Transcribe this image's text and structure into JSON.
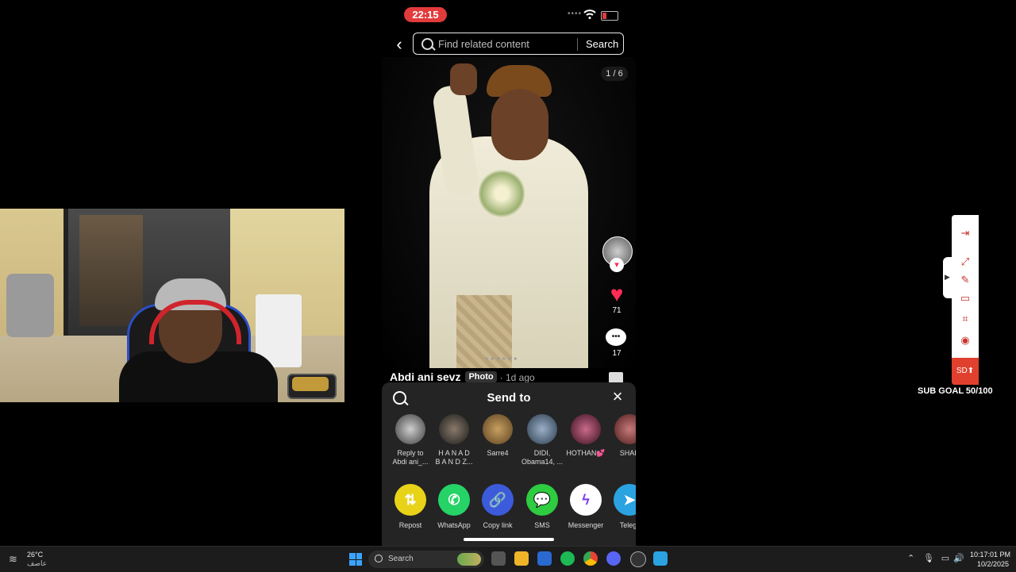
{
  "phone": {
    "status_time": "22:15",
    "search_placeholder": "Find related content",
    "search_button": "Search",
    "page_counter": "1 / 6",
    "like_count": "71",
    "comment_count": "17",
    "author": "Abdi ani  sevz",
    "post_type": "Photo",
    "time_ago": "· 1d ago",
    "share_sheet": {
      "title": "Send to",
      "contacts": [
        {
          "name": "Reply to\nAbdi ani_...",
          "color": "#8a8a8a"
        },
        {
          "name": "H A N A D\nB A N D Z...",
          "color": "#5a4a3a"
        },
        {
          "name": "Sarre4",
          "color": "#a07840"
        },
        {
          "name": "DIDI,\nObama14, ...",
          "color": "#4a6a8a"
        },
        {
          "name": "HOTHAN💕",
          "color": "#7a2a4a"
        },
        {
          "name": "SHAK",
          "color": "#8a3a3a"
        }
      ],
      "apps": [
        {
          "label": "Repost",
          "color": "#e8d318",
          "glyph": "⇅"
        },
        {
          "label": "WhatsApp",
          "color": "#25d366",
          "glyph": "✆"
        },
        {
          "label": "Copy link",
          "color": "#3b5bdb",
          "glyph": "🔗"
        },
        {
          "label": "SMS",
          "color": "#2ecc40",
          "glyph": "💬"
        },
        {
          "label": "Messenger",
          "color": "#ffffff",
          "glyph": "ϟ"
        },
        {
          "label": "Telegr",
          "color": "#2aa3e0",
          "glyph": "➤"
        }
      ]
    }
  },
  "overlay": {
    "sub_goal": "SUB GOAL 50/100",
    "sd_label": "SD⬆"
  },
  "taskbar": {
    "weather_temp": "26°C",
    "weather_desc": "عاصف",
    "search_label": "Search",
    "clock_time": "10:17:01 PM",
    "clock_date": "10/2/2025"
  },
  "colors": {
    "tiktok_red": "#fe2c55",
    "status_red": "#e23b3b",
    "windows_blue": "#3aa3ff"
  }
}
